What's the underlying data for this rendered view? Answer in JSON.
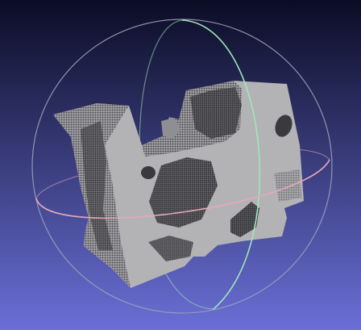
{
  "viewer": {
    "background_top_color": "#0b0c24",
    "background_bottom_color": "#6a6fd6",
    "mesh_color": "#b3b3b6",
    "mesh_shadow_color": "#3e3e42",
    "trackball": {
      "x_axis_ring_color": "#e8a8b8",
      "y_axis_ring_color": "#9ee8b8",
      "z_axis_ring_color": "#9aa0b8"
    }
  }
}
